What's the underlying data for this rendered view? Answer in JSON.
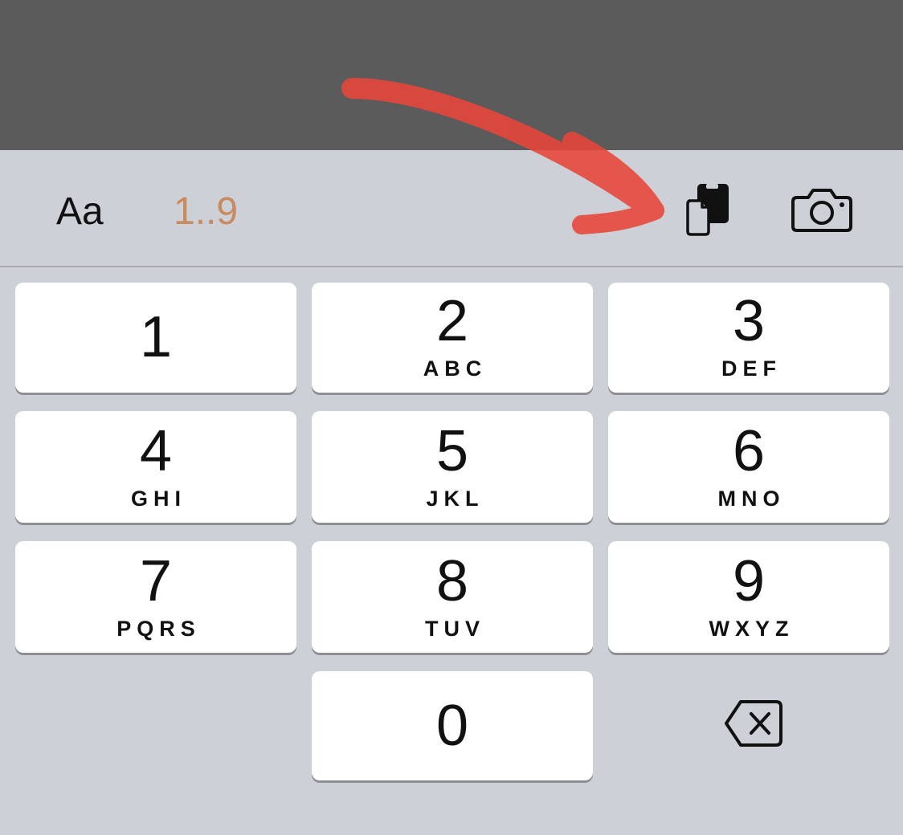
{
  "toolbar": {
    "text_mode_label": "Aa",
    "number_mode_label": "1..9",
    "number_mode_color": "#c98a5f",
    "paste_icon": "clipboard-paste-icon",
    "camera_icon": "camera-icon"
  },
  "keypad": {
    "keys": [
      {
        "digit": "1",
        "letters": ""
      },
      {
        "digit": "2",
        "letters": "ABC"
      },
      {
        "digit": "3",
        "letters": "DEF"
      },
      {
        "digit": "4",
        "letters": "GHI"
      },
      {
        "digit": "5",
        "letters": "JKL"
      },
      {
        "digit": "6",
        "letters": "MNO"
      },
      {
        "digit": "7",
        "letters": "PQRS"
      },
      {
        "digit": "8",
        "letters": "TUV"
      },
      {
        "digit": "9",
        "letters": "WXYZ"
      },
      {
        "digit": "0",
        "letters": ""
      }
    ],
    "backspace_icon": "backspace-icon"
  },
  "annotation": {
    "arrow_color": "#e8463a"
  },
  "colors": {
    "top_area": "#5b5b5b",
    "keyboard_background": "#cdd0d6",
    "key_background": "#ffffff"
  }
}
